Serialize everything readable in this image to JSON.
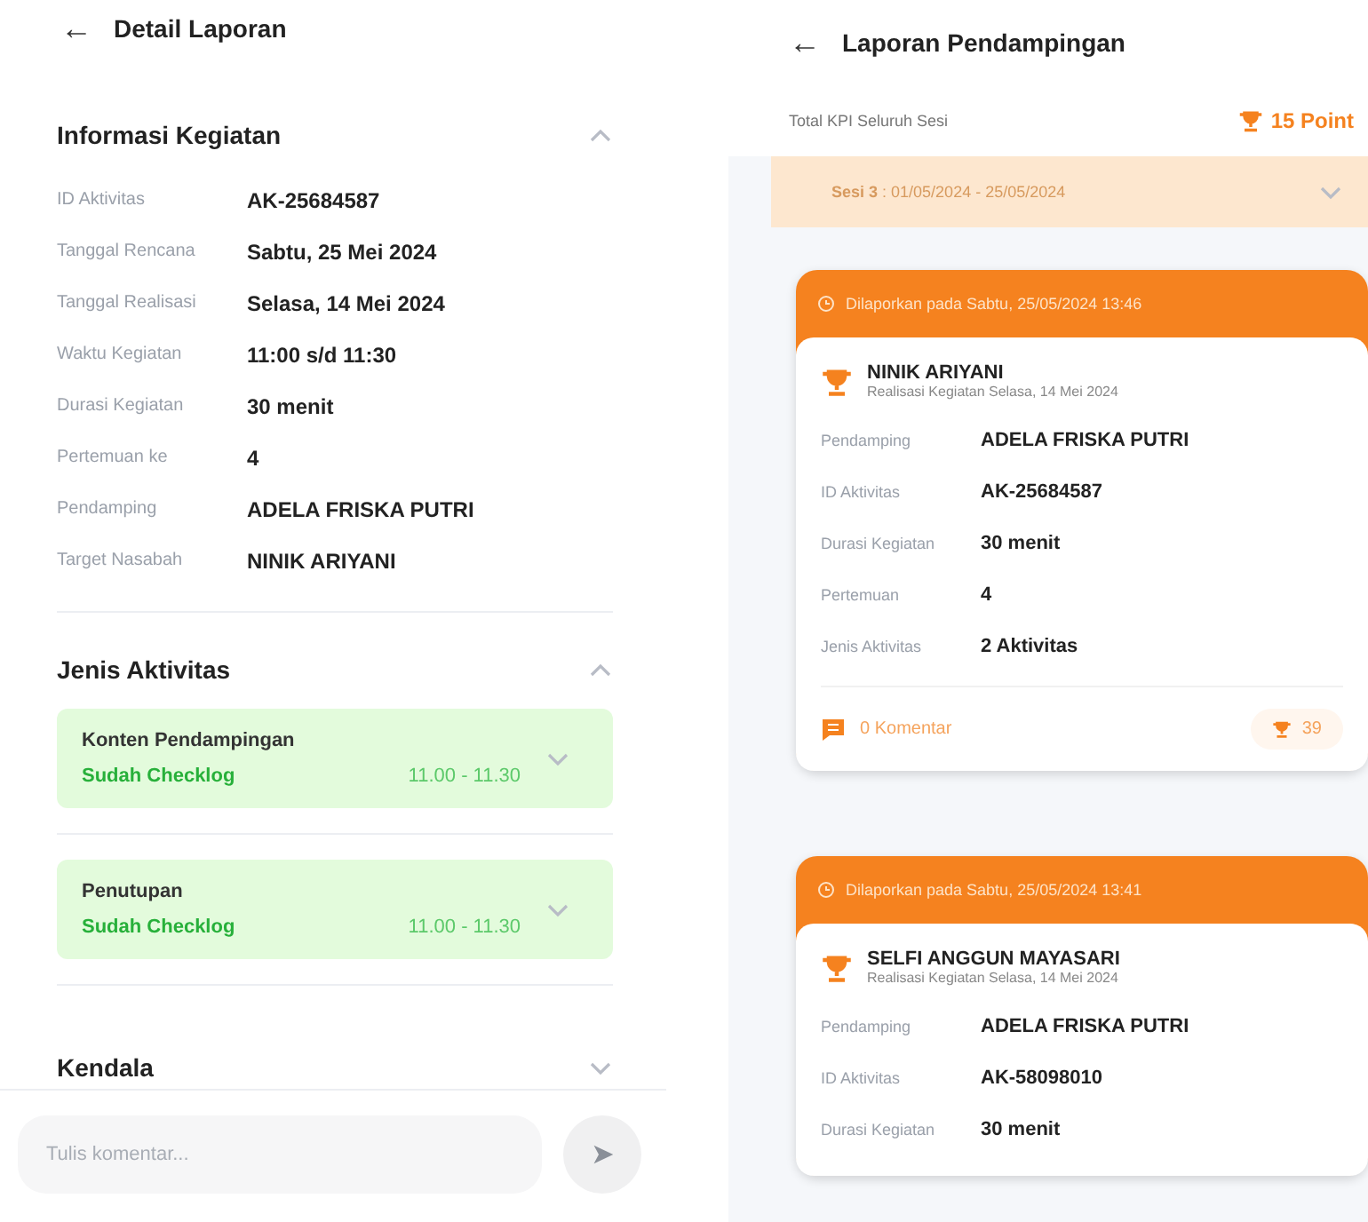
{
  "detail_screen": {
    "header": {
      "back_icon": "←",
      "title": "Detail Laporan"
    },
    "sections": [
      {
        "kind": "info",
        "title": "Informasi Kegiatan",
        "expanded": true,
        "rows": [
          {
            "label": "ID Aktivitas",
            "value": "AK-25684587"
          },
          {
            "label": "Tanggal Rencana",
            "value": "Sabtu, 25 Mei 2024"
          },
          {
            "label": "Tanggal Realisasi",
            "value": "Selasa, 14 Mei 2024"
          },
          {
            "label": "Waktu Kegiatan",
            "value": "11:00 s/d 11:30"
          },
          {
            "label": "Durasi Kegiatan",
            "value": "30 menit"
          },
          {
            "label": "Pertemuan ke",
            "value": "4"
          },
          {
            "label": "Pendamping",
            "value": "ADELA FRISKA PUTRI"
          },
          {
            "label": "Target Nasabah",
            "value": "NINIK ARIYANI"
          }
        ]
      },
      {
        "kind": "activities",
        "title": "Jenis Aktivitas",
        "expanded": true,
        "activities": [
          {
            "name": "Konten Pendampingan",
            "status": "Sudah Checklog",
            "time": "11.00 - 11.30",
            "expanded": false
          },
          {
            "name": "Penutupan",
            "status": "Sudah Checklog",
            "time": "11.00 - 11.30",
            "expanded": false
          }
        ]
      },
      {
        "kind": "plain",
        "title": "Kendala",
        "expanded": false
      }
    ],
    "comment": {
      "placeholder": "Tulis komentar...",
      "send_icon": "➤"
    }
  },
  "report_screen": {
    "header": {
      "back_icon": "←",
      "title": "Laporan Pendampingan"
    },
    "kpi": {
      "label": "Total KPI Seluruh Sesi",
      "points": "15 Point"
    },
    "session": {
      "label": "Sesi 3",
      "range": " : 01/05/2024 - 25/05/2024",
      "expanded": false
    },
    "reports": [
      {
        "reported": "Dilaporkan pada Sabtu, 25/05/2024 13:46",
        "name": "NINIK ARIYANI",
        "subtitle": "Realisasi Kegiatan Selasa, 14 Mei 2024",
        "rows": [
          {
            "label": "Pendamping",
            "value": "ADELA FRISKA PUTRI"
          },
          {
            "label": "ID Aktivitas",
            "value": "AK-25684587"
          },
          {
            "label": "Durasi Kegiatan",
            "value": "30 menit"
          },
          {
            "label": "Pertemuan",
            "value": "4"
          },
          {
            "label": "Jenis Aktivitas",
            "value": "2 Aktivitas"
          }
        ],
        "comments": "0 Komentar",
        "points": "39"
      },
      {
        "reported": "Dilaporkan pada Sabtu, 25/05/2024 13:41",
        "name": "SELFI ANGGUN MAYASARI",
        "subtitle": "Realisasi Kegiatan Selasa, 14 Mei 2024",
        "rows": [
          {
            "label": "Pendamping",
            "value": "ADELA FRISKA PUTRI"
          },
          {
            "label": "ID Aktivitas",
            "value": "AK-58098010"
          },
          {
            "label": "Durasi Kegiatan",
            "value": "30 menit"
          }
        ]
      }
    ]
  }
}
